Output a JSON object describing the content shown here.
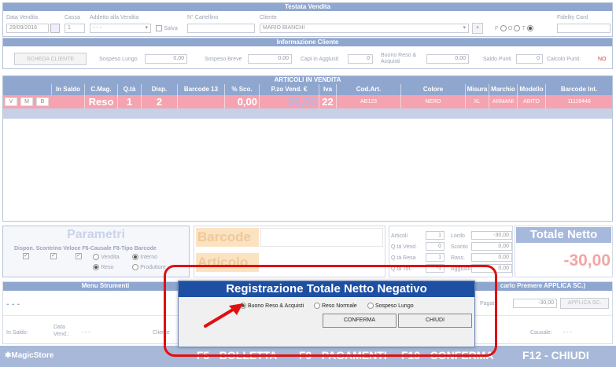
{
  "testata": {
    "title": "Testata Vendita",
    "data_vendita_label": "Data Vendita",
    "data_vendita_value": "29/09/2016",
    "cassa_label": "Cassa",
    "cassa_value": "1",
    "addetto_label": "Addetto alla Vendita",
    "addetto_value": "- - -",
    "salva_label": "Salva",
    "cartellino_label": "N° Cartellino",
    "cliente_label": "Cliente",
    "cliente_value": "MARIO BIANCHI",
    "plus_label": "+",
    "radio_f": "F",
    "radio_o": "O",
    "radio_t": "T",
    "fidelity_label": "Fidelity Card"
  },
  "info_cliente": {
    "title": "Informazione Cliente",
    "scheda_button": "SCHEDA CLIENTE",
    "sospeso_lungo_label": "Sospeso Lungo",
    "sospeso_lungo_value": "0,00",
    "sospeso_breve_label": "Sospeso Breve",
    "sospeso_breve_value": "0,00",
    "capi_label": "Capi in Aggiusti",
    "capi_value": "0",
    "buono_label": "Buono Reso & Acquisti",
    "buono_value": "0,00",
    "saldo_punti_label": "Saldo Punti",
    "saldo_punti_value": "0",
    "calcolo_punti_label": "Calcolo Punti:",
    "calcolo_punti_value": "NO"
  },
  "articoli": {
    "title": "ARTICOLI IN VENDITA",
    "headers": [
      "In Saldo",
      "C.Mag.",
      "Q.tà",
      "Disp.",
      "Barcode 13",
      "% Sco.",
      "P.zo Vend. €",
      "Iva",
      "Cod.Art.",
      "Colore",
      "Misura",
      "Marchio",
      "Modello",
      "Barcode Int."
    ],
    "row": {
      "v": "V",
      "m": "M",
      "b": "B",
      "cmag": "Reso",
      "qta": "1",
      "disp": "2",
      "sco": "0,00",
      "prezzo": "30,00",
      "iva": "22",
      "codart": "AB123",
      "colore": "NERO",
      "misura": "XL",
      "marchio": "ARMANI",
      "modello": "ABITO",
      "barcode_int": "11119446"
    }
  },
  "parametri": {
    "title": "Parametri",
    "sub": "Dispon. Scontrino Veloce F6-Causale F8-Tipo Barcode",
    "vendita": "Vendita",
    "interno": "Interno",
    "reso": "Reso",
    "produttore": "Produttore"
  },
  "barcode_label": "Barcode",
  "articolo_label": "Articolo",
  "totali": {
    "articoli_label": "Articoli",
    "articoli_value": "1",
    "lordo_label": "Lordo",
    "lordo_value": "-30,00",
    "qta_vend_label": "Q.tà Vend.",
    "qta_vend_value": "0",
    "sconto_label": "Sconto",
    "sconto_value": "0,00",
    "qta_resa_label": "Q.tà Resa",
    "qta_resa_value": "1",
    "rass_label": "Rass.",
    "rass_value": "0,00",
    "qta_tot_label": "Q.tà Tot.",
    "qta_tot_value": "-1",
    "aggiusti_label": "Aggiusti",
    "aggiusti_value": "0,00"
  },
  "totale_netto": {
    "label": "Totale Netto",
    "value": "-30,00"
  },
  "menu_strumenti": {
    "title": "Menu Strumenti",
    "dashes": "- - -"
  },
  "bottom": {
    "in_saldo": "In Saldo:",
    "data_vend": "Data Vend.:",
    "data_vend_value": "- - -",
    "cliente": "Cliente",
    "causale": "Causale:",
    "causale_value": "- - -",
    "premere": "carlo Premere APPLICA SC.)",
    "pagato": "Pagat",
    "pagato_value": "-30,00",
    "applica": "APPLICA SC."
  },
  "footer": {
    "brand": "MagicStore",
    "f5": "F5 - BOLLETTA",
    "f9": "F9 - PAGAMENTI",
    "f10": "F10 - CONFERMA",
    "f12": "F12 - CHIUDI"
  },
  "dialog": {
    "title": "Registrazione Totale Netto Negativo",
    "opt1": "Buono Reso & Acquisti",
    "opt2": "Reso Normale",
    "opt3": "Sospeso Lungo",
    "conferma": "CONFERMA",
    "chiudi": "CHIUDI"
  },
  "colors": {
    "band": "#8fa6cf",
    "row": "#f5a3b1",
    "highlight": "#e01010",
    "dialog_header": "#1d4fa3"
  }
}
